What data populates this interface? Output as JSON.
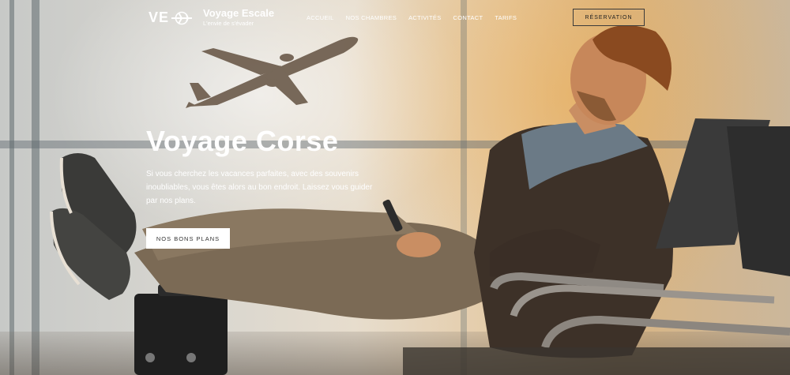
{
  "header": {
    "logo_letters": "VE",
    "brand_name": "Voyage Escale",
    "brand_tagline": "L'envie de s'évader",
    "nav": [
      {
        "label": "ACCUEIL"
      },
      {
        "label": "NOS CHAMBRES"
      },
      {
        "label": "ACTIVITÉS"
      },
      {
        "label": "CONTACT"
      },
      {
        "label": "TARIFS"
      }
    ],
    "reserve_label": "RÉSERVATION"
  },
  "hero": {
    "title": "Voyage Corse",
    "text": "Si vous cherchez les vacances parfaites, avec des souvenirs inoubliables, vous êtes alors au bon endroit. Laissez vous guider par nos plans.",
    "cta_label": "NOS BONS PLANS"
  },
  "icons": {
    "logo": "airplane-icon"
  },
  "colors": {
    "text_light": "#ffffff",
    "button_bg": "#ffffff",
    "button_text": "#333333",
    "outline": "#3a3a3a"
  }
}
